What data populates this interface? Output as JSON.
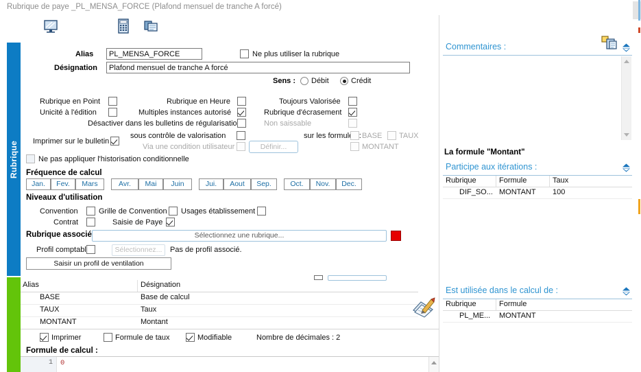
{
  "window": {
    "title": "Rubrique de paye _PL_MENSA_FORCE (Plafond mensuel de tranche A forcé)"
  },
  "toolbar": {
    "icons": [
      {
        "name": "screen-icon",
        "label": "Écran"
      },
      {
        "name": "calculator-icon",
        "label": "Calculatrice"
      },
      {
        "name": "window-copy-icon",
        "label": "Fenêtre"
      },
      {
        "name": "copy-document-icon",
        "label": "Copier"
      }
    ]
  },
  "rail": {
    "blue_label": "Rubrique"
  },
  "identity": {
    "alias_label": "Alias",
    "alias_value": "PL_MENSA_FORCE",
    "designation_label": "Désignation",
    "designation_value": "Plafond mensuel de tranche A forcé",
    "disable_label": "Ne plus utiliser la rubrique",
    "disable_checked": false,
    "sens_label": "Sens :",
    "sens_debit": "Débit",
    "sens_credit": "Crédit",
    "sens_selected": "Crédit"
  },
  "options": {
    "rubrique_en_point": {
      "label": "Rubrique en Point",
      "checked": false
    },
    "unicite_edition": {
      "label": "Unicité à l'édition",
      "checked": false
    },
    "rubrique_en_heure": {
      "label": "Rubrique en Heure",
      "checked": false
    },
    "multiples_instances": {
      "label": "Multiples instances autorisé",
      "checked": true
    },
    "toujours_valorisee": {
      "label": "Toujours Valorisée",
      "checked": false
    },
    "rubrique_ecrasement": {
      "label": "Rubrique d'écrasement",
      "checked": true
    },
    "desactiver_bulletins": {
      "label": "Désactiver dans les bulletins de régularisation",
      "checked": false
    },
    "non_saissable": {
      "label": "Non saissable",
      "checked": false,
      "disabled": true
    },
    "imprimer_bulletin": {
      "label": "Imprimer sur le bulletin",
      "checked": true
    },
    "sous_controle": {
      "label": "sous contrôle de valorisation",
      "checked": false
    },
    "via_condition": {
      "label": "Via une condition utilisateur",
      "checked": false,
      "disabled": true
    },
    "definir_button": {
      "label": "Définir...",
      "disabled": true
    },
    "sur_les_formules": {
      "label": "sur les formules :"
    },
    "formule_base": {
      "label": "BASE",
      "checked": false,
      "disabled": true
    },
    "formule_taux": {
      "label": "TAUX",
      "checked": false,
      "disabled": true
    },
    "formule_montant": {
      "label": "MONTANT",
      "checked": false,
      "disabled": true
    },
    "ne_pas_historisation": {
      "label": "Ne pas appliquer l'historisation conditionnelle",
      "checked": false
    }
  },
  "frequency": {
    "title": "Fréquence de calcul",
    "months": [
      "Jan.",
      "Fev.",
      "Mars",
      "Avr.",
      "Mai",
      "Juin",
      "Jui.",
      "Aout",
      "Sep.",
      "Oct.",
      "Nov.",
      "Dec."
    ]
  },
  "usage_levels": {
    "title": "Niveaux d'utilisation",
    "convention": {
      "label": "Convention",
      "checked": false
    },
    "grille_convention": {
      "label": "Grille de Convention",
      "checked": false
    },
    "usages_etablissement": {
      "label": "Usages établissement",
      "checked": false
    },
    "contrat": {
      "label": "Contrat",
      "checked": false
    },
    "saisie_paye": {
      "label": "Saisie de Paye",
      "checked": true
    }
  },
  "associated": {
    "label": "Rubrique associée",
    "placeholder": "Sélectionnez une rubrique...",
    "profil_label": "Profil comptable",
    "profil_checked": false,
    "profil_button": "Sélectionnez...",
    "profil_status": "Pas de profil associé.",
    "ventilation_button": "Saisir un profil de ventilation"
  },
  "variables": {
    "headers": [
      "Alias",
      "Désignation"
    ],
    "rows": [
      {
        "alias": "BASE",
        "designation": "Base de calcul"
      },
      {
        "alias": "TAUX",
        "designation": "Taux"
      },
      {
        "alias": "MONTANT",
        "designation": "Montant"
      }
    ],
    "imprimer": {
      "label": "Imprimer",
      "checked": true
    },
    "formule_taux": {
      "label": "Formule de taux",
      "checked": false
    },
    "modifiable": {
      "label": "Modifiable",
      "checked": true
    },
    "decimales_label": "Nombre de décimales : 2",
    "edit-icon": "notepad-pencil-icon"
  },
  "formula": {
    "title": "Formule de calcul :",
    "line_number": "1",
    "code": "0"
  },
  "right": {
    "comments": {
      "title": "Commentaires :",
      "value": ""
    },
    "montant_title": "La formule \"Montant\"",
    "iterations": {
      "title": "Participe aux itérations :",
      "headers": [
        "Rubrique",
        "Formule",
        "Taux"
      ],
      "rows": [
        {
          "rubrique": "DIF_SO...",
          "formule": "MONTANT",
          "taux": "100"
        }
      ]
    },
    "used_in": {
      "title": "Est utilisée dans le calcul de :",
      "headers": [
        "Rubrique",
        "Formule"
      ],
      "rows": [
        {
          "rubrique": "PL_ME...",
          "formule": "MONTANT"
        }
      ]
    }
  },
  "colors": {
    "rail_blue": "#0d7cc4",
    "rail_green": "#63c40a",
    "accent_blue": "#2f94d1",
    "month_text": "#1c6ea4",
    "red_box": "#e60000",
    "code_red": "#b03030"
  }
}
